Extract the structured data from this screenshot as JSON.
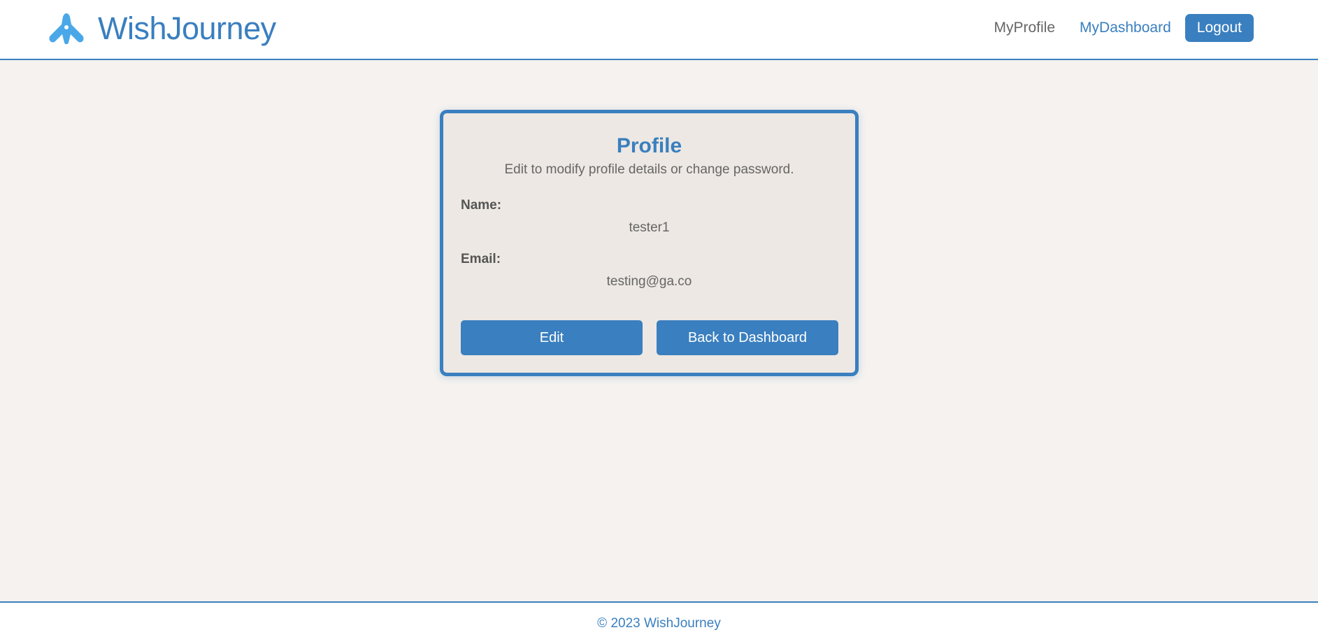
{
  "header": {
    "brand_name": "WishJourney",
    "nav": {
      "profile_label": "MyProfile",
      "dashboard_label": "MyDashboard",
      "logout_label": "Logout"
    }
  },
  "card": {
    "title": "Profile",
    "subtitle": "Edit to modify profile details or change password.",
    "fields": [
      {
        "label": "Name:",
        "value": "tester1"
      },
      {
        "label": "Email:",
        "value": "testing@ga.co"
      }
    ],
    "edit_label": "Edit",
    "back_label": "Back to Dashboard"
  },
  "footer": {
    "text": "© 2023 WishJourney"
  },
  "colors": {
    "accent": "#3a7fbf",
    "page_bg": "#f5f2ef",
    "card_bg": "#ede8e3",
    "logo_icon": "#4aa8e8"
  },
  "icons": {
    "brand": "airplane-icon"
  }
}
